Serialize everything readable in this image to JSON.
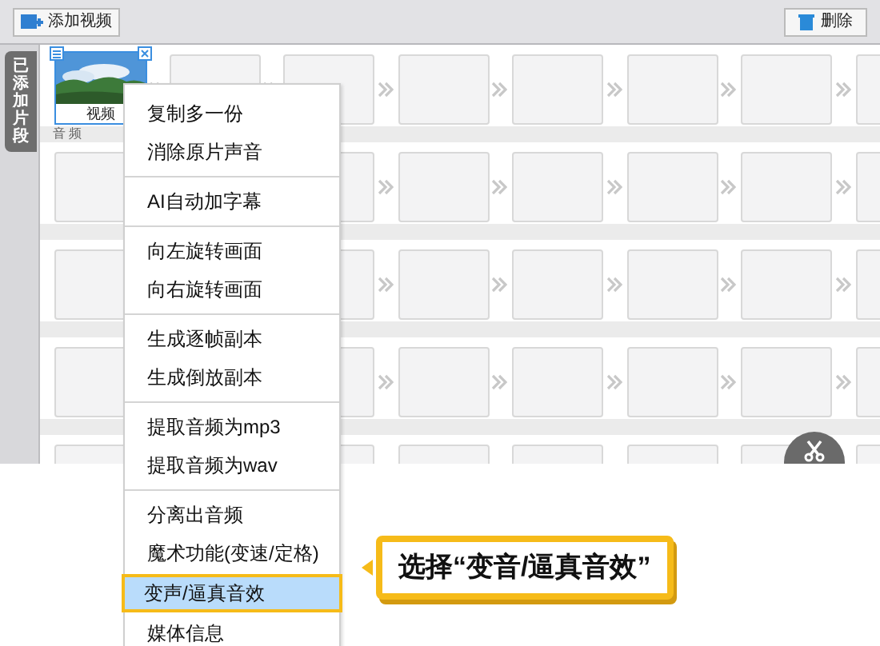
{
  "toolbar": {
    "add_button": "添加视频",
    "delete_button": "删除"
  },
  "side_tab": {
    "label": "已添加片段",
    "selected": true
  },
  "clip": {
    "label": "视频"
  },
  "track_label": "音 频",
  "menu": {
    "groups": [
      {
        "items": [
          {
            "label": "复制多一份",
            "selected": false
          },
          {
            "label": "消除原片声音",
            "selected": false
          }
        ]
      },
      {
        "items": [
          {
            "label": "AI自动加字幕",
            "selected": false
          }
        ]
      },
      {
        "items": [
          {
            "label": "向左旋转画面",
            "selected": false
          },
          {
            "label": "向右旋转画面",
            "selected": false
          }
        ]
      },
      {
        "items": [
          {
            "label": "生成逐帧副本",
            "selected": false
          },
          {
            "label": "生成倒放副本",
            "selected": false
          }
        ]
      },
      {
        "items": [
          {
            "label": "提取音频为mp3",
            "selected": false
          },
          {
            "label": "提取音频为wav",
            "selected": false
          }
        ]
      },
      {
        "items": [
          {
            "label": "分离出音频",
            "selected": false
          },
          {
            "label": "魔术功能(变速/定格)",
            "selected": false
          },
          {
            "label": "变声/逼真音效",
            "selected": true
          },
          {
            "label": "媒体信息",
            "selected": false
          }
        ]
      }
    ]
  },
  "callout": "选择“变音/逼真音效”"
}
